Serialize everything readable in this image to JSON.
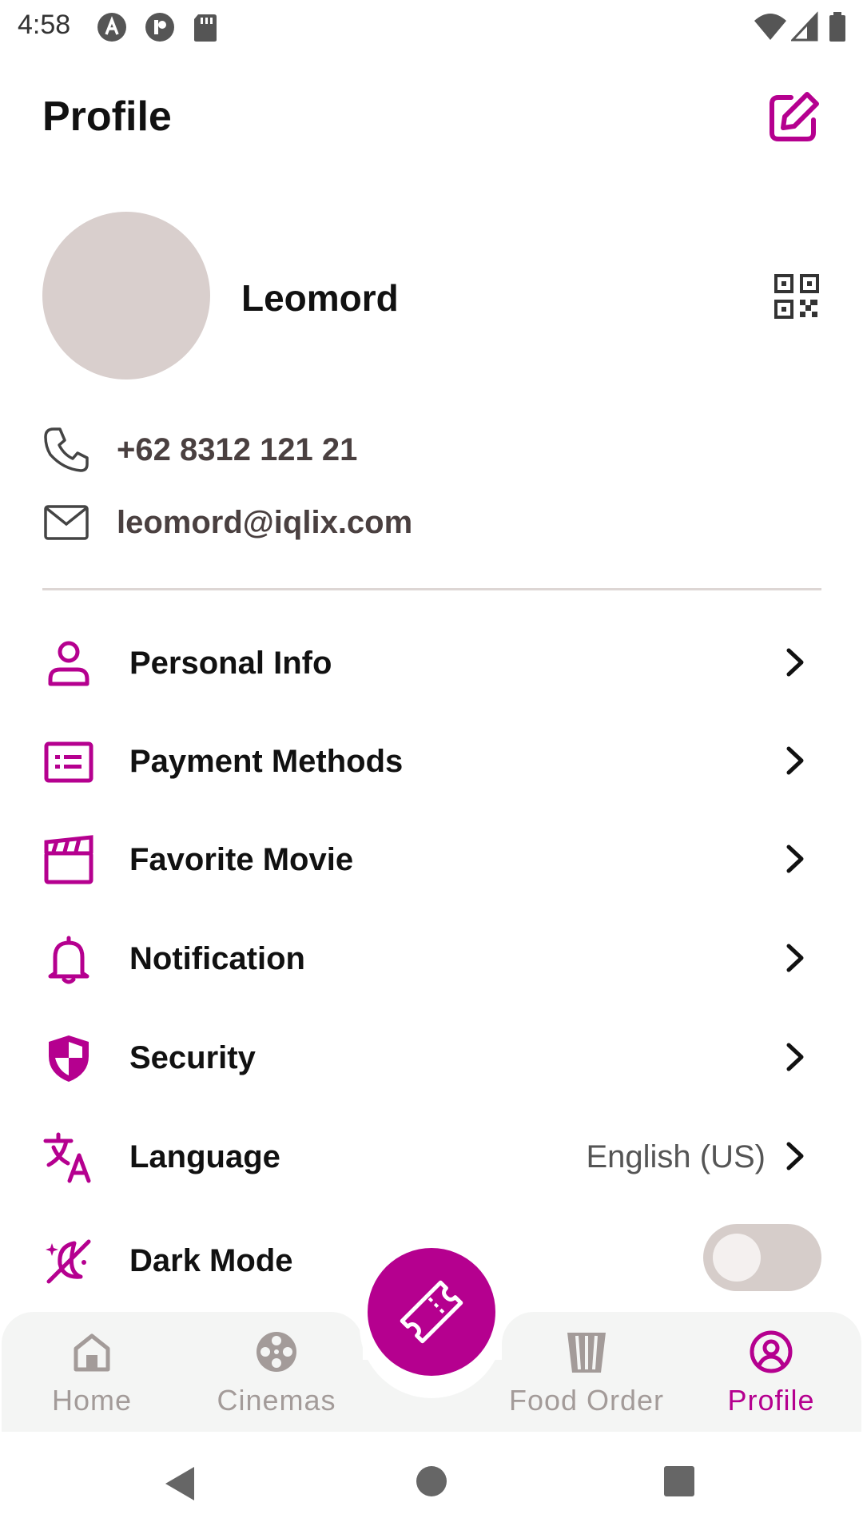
{
  "status_bar": {
    "time": "4:58",
    "icons": [
      "autofill-icon",
      "pocket-icon",
      "sd-card-icon",
      "wifi-icon",
      "signal-icon",
      "battery-icon"
    ]
  },
  "header": {
    "title": "Profile",
    "edit_icon": "edit-icon"
  },
  "profile": {
    "name": "Leomord",
    "phone": "+62 8312 121 21",
    "email": "leomord@iqlix.com",
    "qr_icon": "qr-code-icon"
  },
  "menu": {
    "items": [
      {
        "label": "Personal Info",
        "icon": "person-icon"
      },
      {
        "label": "Payment Methods",
        "icon": "card-icon"
      },
      {
        "label": "Favorite Movie",
        "icon": "clapperboard-icon"
      },
      {
        "label": "Notification",
        "icon": "bell-icon"
      },
      {
        "label": "Security",
        "icon": "shield-icon"
      },
      {
        "label": "Language",
        "icon": "translate-icon",
        "value": "English (US)"
      },
      {
        "label": "Dark Mode",
        "icon": "dark-mode-icon",
        "toggle": false
      }
    ]
  },
  "bottom_nav": {
    "items": [
      {
        "label": "Home",
        "icon": "home-icon",
        "active": false
      },
      {
        "label": "Cinemas",
        "icon": "film-reel-icon",
        "active": false
      },
      {
        "label": "Food Order",
        "icon": "popcorn-icon",
        "active": false
      },
      {
        "label": "Profile",
        "icon": "user-circle-icon",
        "active": true
      }
    ],
    "fab_icon": "ticket-icon"
  },
  "colors": {
    "accent": "#b5008f",
    "text": "#111111",
    "muted": "#a39b99",
    "avatar": "#d9cfcd",
    "nav_bg": "#f4f5f4"
  }
}
